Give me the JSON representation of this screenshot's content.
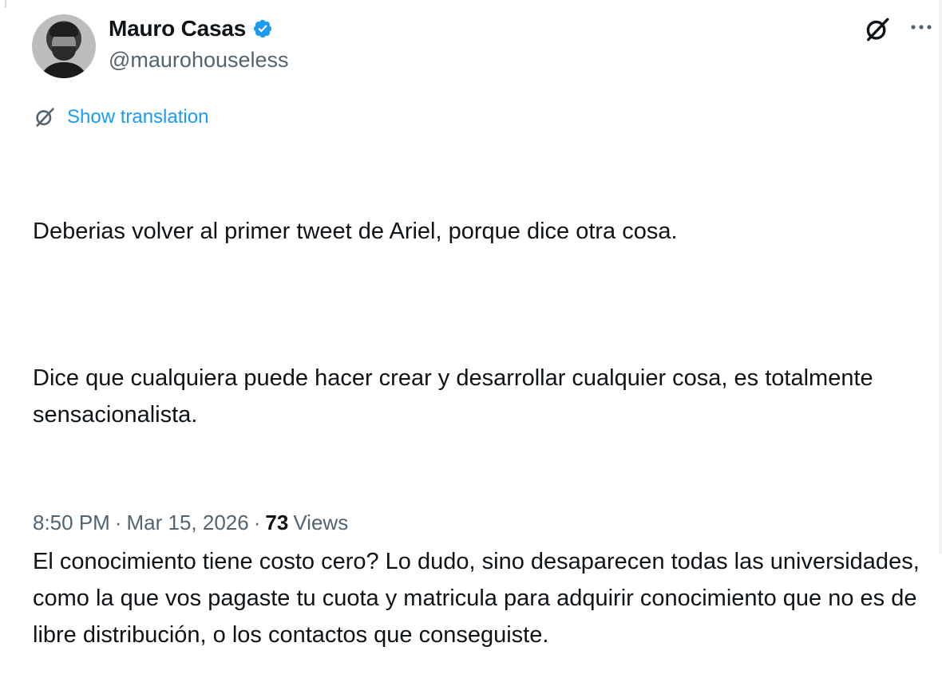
{
  "author": {
    "display_name": "Mauro Casas",
    "handle": "@maurohouseless",
    "verified": true,
    "verified_color": "#1d9bf0"
  },
  "actions": {
    "grok_icon": "grok-icon",
    "more_icon": "more-icon"
  },
  "translation": {
    "label": "Show translation",
    "link_color": "#1d9bf0"
  },
  "tweet": {
    "paragraphs": [
      "Deberias volver al primer tweet de Ariel, porque dice otra cosa.",
      "Dice que cualquiera puede hacer crear y desarrollar cualquier cosa, es totalmente sensacionalista.",
      "El conocimiento tiene costo cero? Lo dudo, sino desaparecen todas las universidades, como la que vos pagaste tu cuota y matricula para adquirir conocimiento que no es de libre distribución, o los contactos que conseguiste."
    ]
  },
  "meta": {
    "time": "8:50 PM",
    "date": "Mar 15, 2026",
    "separator": "·",
    "views_count": "73",
    "views_label": "Views"
  }
}
